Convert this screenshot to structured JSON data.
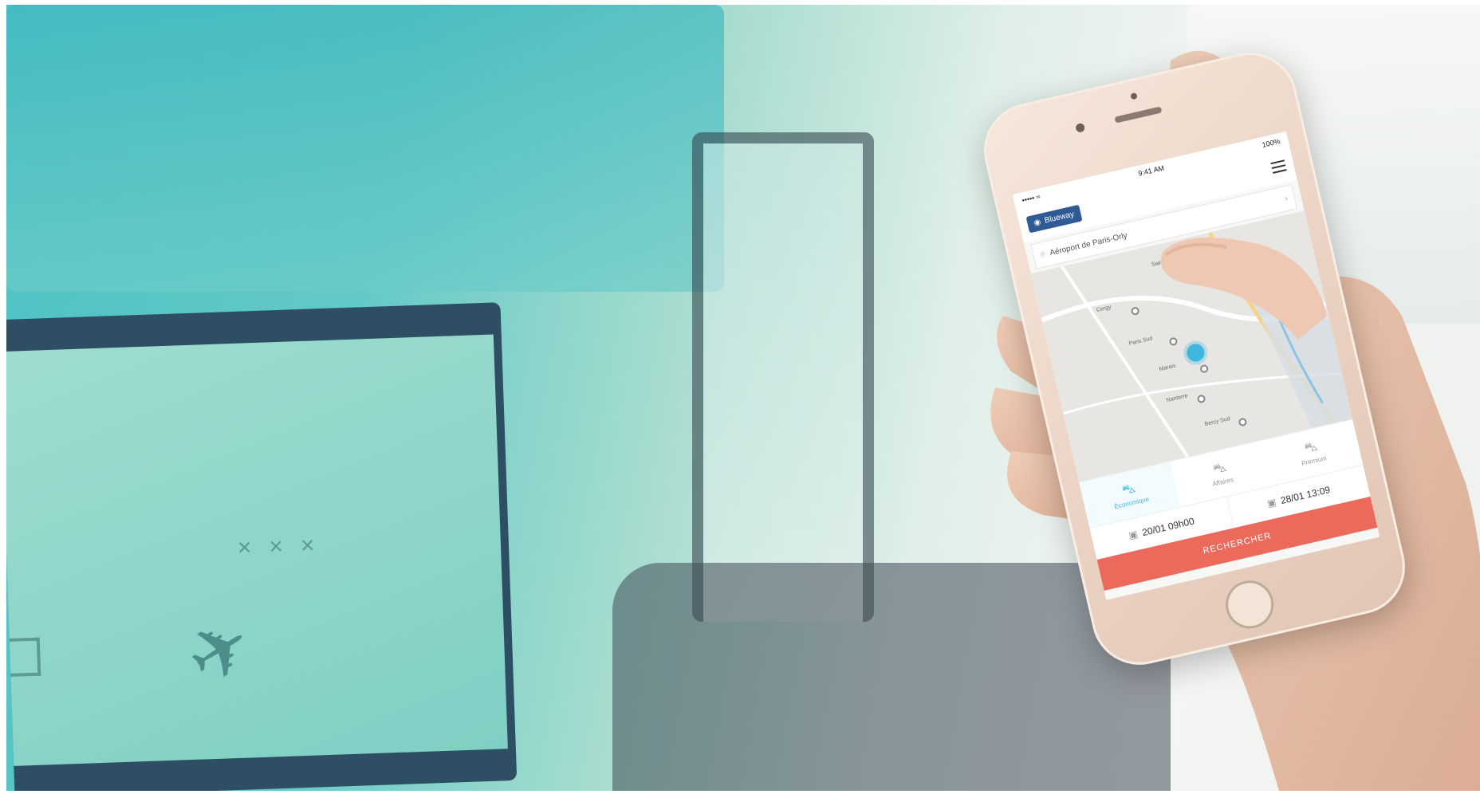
{
  "phone_ui": {
    "status_left": "••••• ≈",
    "status_time": "9:41 AM",
    "status_battery": "100%",
    "brand": "Blueway",
    "search_value": "Aéroport de Paris-Orly",
    "map_labels": [
      "Cergy",
      "Paris Sud",
      "Marais",
      "Saint-Denis",
      "Nanterre",
      "Bercy Sud"
    ],
    "vehicle_tabs": [
      {
        "label": "Économique",
        "icon": "car-icon",
        "active": true
      },
      {
        "label": "Affaires",
        "icon": "car-icon",
        "active": false
      },
      {
        "label": "Premium",
        "icon": "car-icon",
        "active": false
      }
    ],
    "date_from": "20/01 09h00",
    "date_to": "28/01 13:09",
    "search_button": "RECHERCHER"
  },
  "colors": {
    "accent": "#3fb6dd",
    "button": "#ec6a5c",
    "brand": "#2f5a93",
    "teal_bg": "#4dc2c6"
  }
}
